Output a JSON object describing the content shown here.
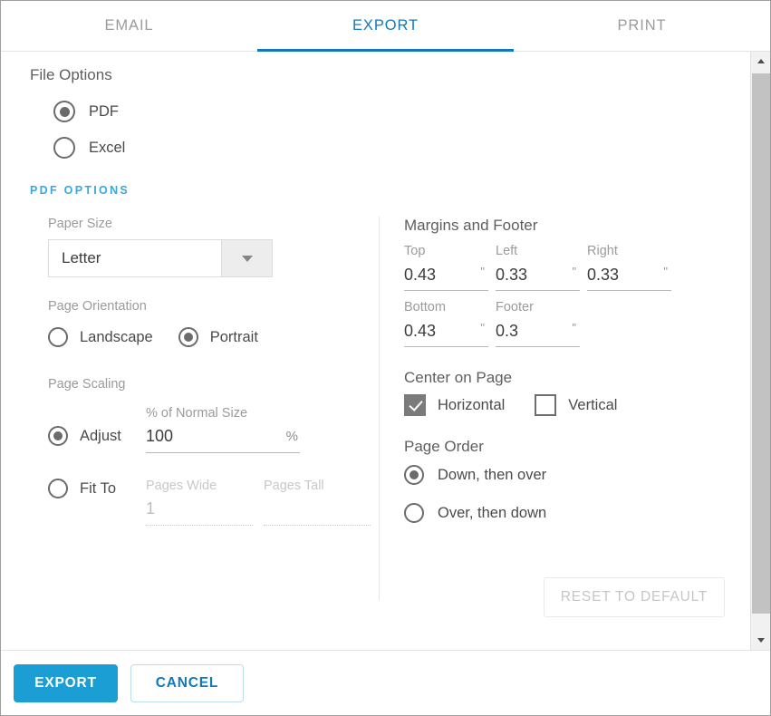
{
  "tabs": [
    {
      "label": "EMAIL",
      "active": false
    },
    {
      "label": "EXPORT",
      "active": true
    },
    {
      "label": "PRINT",
      "active": false
    }
  ],
  "file_options": {
    "title": "File Options",
    "pdf_label": "PDF",
    "excel_label": "Excel",
    "selected": "PDF"
  },
  "pdf_options_heading": "PDF OPTIONS",
  "paper_size": {
    "label": "Paper Size",
    "value": "Letter"
  },
  "page_orientation": {
    "label": "Page Orientation",
    "landscape_label": "Landscape",
    "portrait_label": "Portrait",
    "selected": "Portrait"
  },
  "page_scaling": {
    "label": "Page Scaling",
    "adjust_label": "Adjust",
    "fit_to_label": "Fit To",
    "selected": "Adjust",
    "normal_size_label": "% of Normal Size",
    "normal_size_value": "100",
    "percent_suffix": "%",
    "pages_wide_label": "Pages Wide",
    "pages_wide_value": "1",
    "pages_tall_label": "Pages Tall",
    "pages_tall_value": ""
  },
  "margins": {
    "title": "Margins and Footer",
    "inch_symbol": "\"",
    "fields": [
      {
        "label": "Top",
        "value": "0.43"
      },
      {
        "label": "Left",
        "value": "0.33"
      },
      {
        "label": "Right",
        "value": "0.33"
      },
      {
        "label": "Bottom",
        "value": "0.43"
      },
      {
        "label": "Footer",
        "value": "0.3"
      }
    ]
  },
  "center_on_page": {
    "title": "Center on Page",
    "horizontal_label": "Horizontal",
    "horizontal_checked": true,
    "vertical_label": "Vertical",
    "vertical_checked": false
  },
  "page_order": {
    "title": "Page Order",
    "down_then_over_label": "Down, then over",
    "over_then_down_label": "Over, then down",
    "selected": "Down, then over"
  },
  "reset_button": "RESET TO DEFAULT",
  "footer": {
    "export_label": "EXPORT",
    "cancel_label": "CANCEL"
  },
  "colors": {
    "accent_blue": "#1278b8",
    "primary_button": "#1b9ed4",
    "pdf_options_blue": "#3aa8dc",
    "muted_gray": "#9b9b9b"
  }
}
